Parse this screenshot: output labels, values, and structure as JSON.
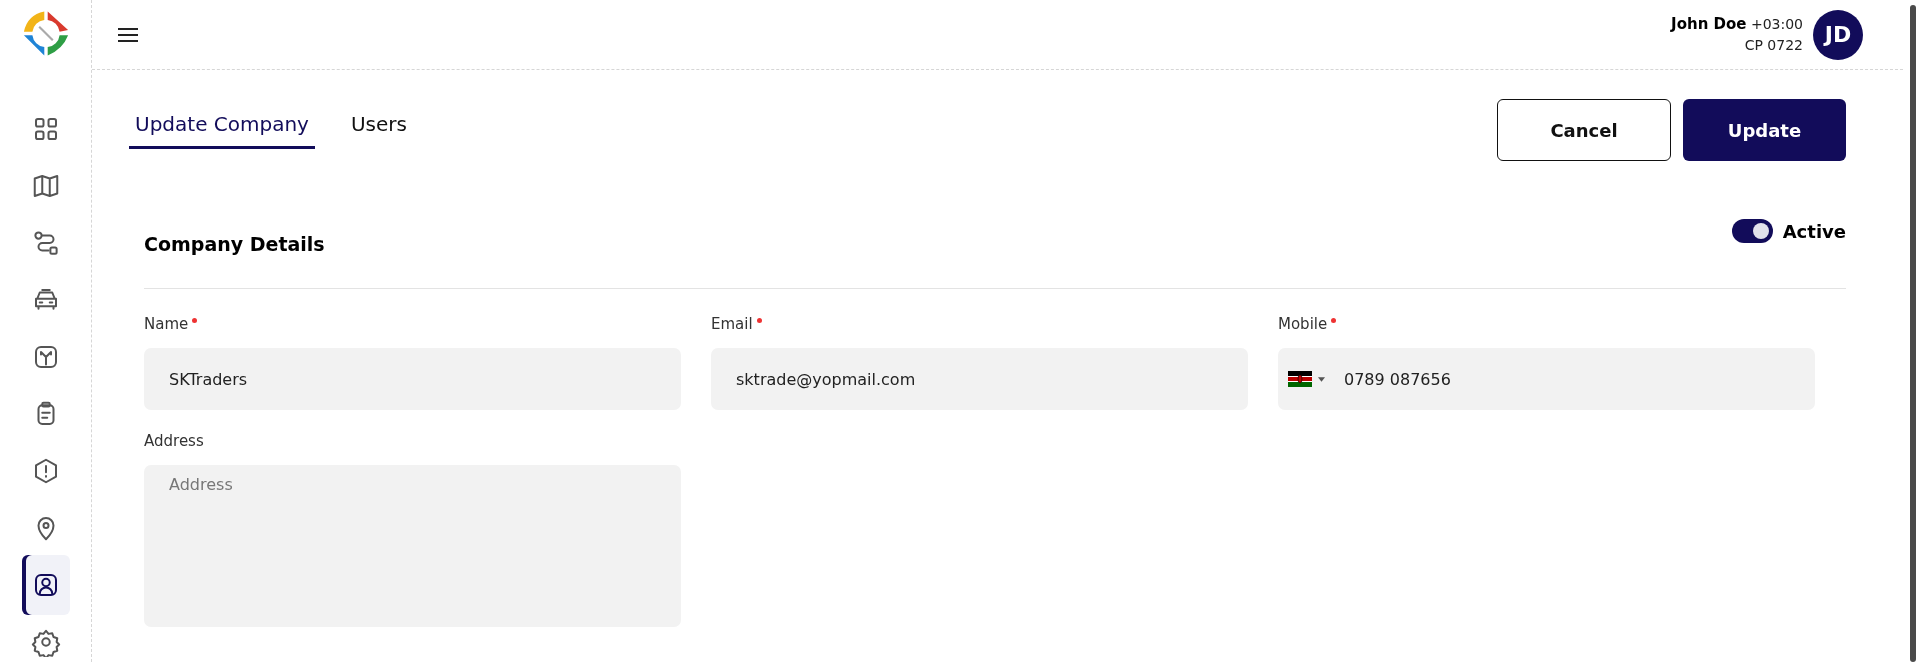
{
  "sidebar": {
    "items": [
      {
        "selected": false
      },
      {
        "selected": false
      },
      {
        "selected": false
      },
      {
        "selected": false
      },
      {
        "selected": false
      },
      {
        "selected": false
      },
      {
        "selected": false
      },
      {
        "selected": false
      },
      {
        "selected": true
      },
      {
        "selected": false
      }
    ]
  },
  "header": {
    "user_name": "John Doe",
    "timezone": "+03:00",
    "code": "CP 0722",
    "avatar_initials": "JD"
  },
  "tabs": [
    {
      "label": "Update Company",
      "selected": true
    },
    {
      "label": "Users",
      "selected": false
    }
  ],
  "buttons": {
    "cancel": "Cancel",
    "update": "Update"
  },
  "section": {
    "title": "Company Details",
    "status_toggle": {
      "label": "Active",
      "on": true
    }
  },
  "fields": [
    {
      "label": "Name",
      "required": true,
      "value": "SKTraders"
    },
    {
      "label": "Email",
      "required": true,
      "value": "sktrade@yopmail.com"
    },
    {
      "label": "Mobile",
      "required": true,
      "value": "0789 087656",
      "kind": "phone"
    }
  ],
  "address": {
    "label": "Address",
    "placeholder": "Address"
  }
}
